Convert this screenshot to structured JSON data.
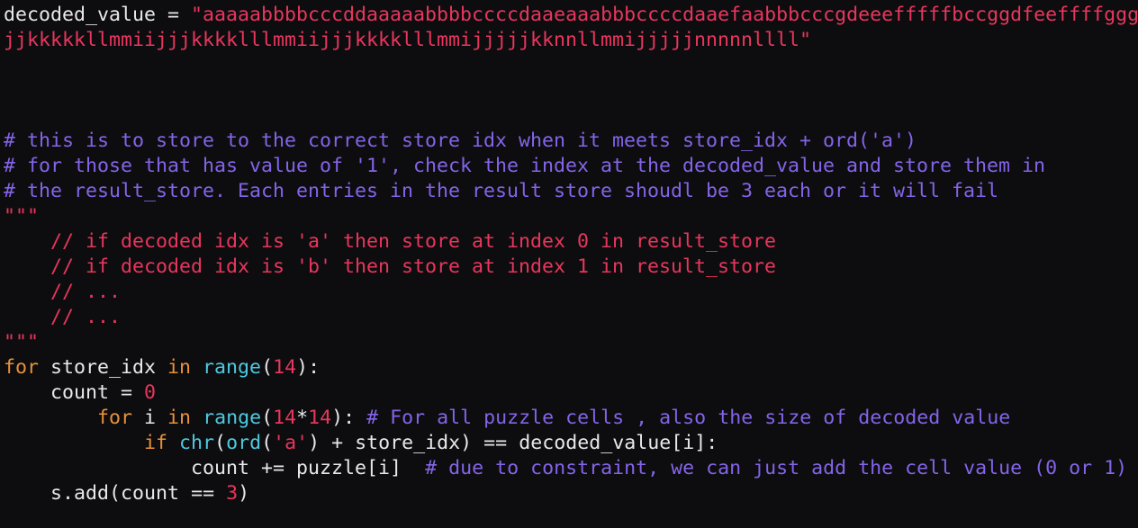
{
  "editor": {
    "background_color": "#0d0d0f",
    "theme_name": "dark",
    "font_size_px": "21.6",
    "line_height_px": "28",
    "language": "python"
  },
  "palette": {
    "foreground": "#e8e8ea",
    "string": "#e8365d",
    "comment": "#8464e8",
    "keyword": "#e8913a",
    "builtin": "#4ec9e0",
    "number": "#e8365d",
    "punctuation": "#e8e8ea"
  },
  "code": {
    "assignment": {
      "variable": "decoded_value",
      "operator": " = ",
      "quote_open": "\"",
      "string_part_1": "aaaaabbbbcccddaaaaabbbbccccdaaeaaabbbccccdaaefaabbbcccgdeeefffffbccggdfeeffffggg",
      "string_part_2": "jjkkkkkllmmiijjjkkkklllmmiijjjkkkklllmmijjjjjkknnllmmijjjjjnnnnnllll",
      "quote_close": "\""
    },
    "comments": [
      "# this is to store to the correct store idx when it meets store_idx + ord('a')",
      "# for those that has value of '1', check the index at the decoded_value and store them in",
      "# the result_store. Each entries in the result store shoudl be 3 each or it will fail"
    ],
    "docstring": {
      "delimiter": "\"\"\"",
      "lines": [
        "    // if decoded idx is 'a' then store at index 0 in result_store",
        "    // if decoded idx is 'b' then store at index 1 in result_store",
        "    // ...",
        "    // ..."
      ]
    },
    "loop": {
      "for_kw": "for",
      "loop_var": " store_idx ",
      "in_kw": "in",
      "range_fn": " range",
      "paren_open": "(",
      "range_arg": "14",
      "paren_close": ")",
      "colon": ":"
    },
    "count_init": {
      "indent": "    ",
      "name": "count",
      "operator": " = ",
      "value": "0"
    },
    "inner_loop": {
      "indent": "        ",
      "for_kw": "for",
      "loop_var": " i ",
      "in_kw": "in",
      "range_fn": " range",
      "paren_open": "(",
      "arg_a": "14",
      "star": "*",
      "arg_b": "14",
      "paren_close": ")",
      "colon": ": ",
      "comment": "# For all puzzle cells , also the size of decoded value"
    },
    "if_stmt": {
      "indent": "            ",
      "if_kw": "if",
      "chr_fn": " chr",
      "paren_open": "(",
      "ord_fn": "ord",
      "ord_paren_open": "(",
      "char_literal": "'a'",
      "ord_paren_close": ")",
      "plus": " + ",
      "var": "store_idx",
      "paren_close": ")",
      "compare": " == ",
      "target": "decoded_value[i]",
      "colon": ":"
    },
    "count_add": {
      "indent": "                ",
      "name": "count",
      "operator": " += ",
      "value": "puzzle[i]",
      "gap": "  ",
      "comment": "# due to constraint, we can just add the cell value (0 or 1)"
    },
    "s_add": {
      "indent": "    ",
      "object": "s.add",
      "paren_open": "(",
      "arg_name": "count",
      "compare": " == ",
      "arg_value": "3",
      "paren_close": ")"
    }
  }
}
